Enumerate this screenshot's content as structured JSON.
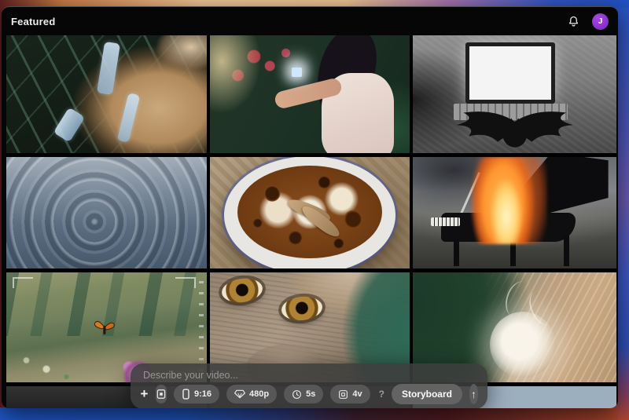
{
  "header": {
    "title": "Featured",
    "avatar_initial": "J"
  },
  "gallery": {
    "tiles": [
      {
        "description": "Macro of translucent glass straws among dark seaweed strands"
      },
      {
        "description": "Girl in a greenhouse holding a small glowing cube above her hands"
      },
      {
        "description": "Black-and-white shot of a bat spreading wings in front of an open laptop"
      },
      {
        "description": "Concentric ripples spreading on calm blue-grey water"
      },
      {
        "description": "Top-down coffee cup with foam bubbles and an insect on the surface"
      },
      {
        "description": "Grand piano burning with orange flames on a grey beach"
      },
      {
        "description": "Orange butterfly flying over rolling green hills with a pink flower"
      },
      {
        "description": "Close-up of a monkey's amber eyes beside teal leaves"
      },
      {
        "description": "White dandelion seed head nestled in strands of blonde hair"
      },
      {
        "description": "Partially visible video thumbnail"
      },
      {
        "description": "Partially visible video thumbnail"
      },
      {
        "description": "Partially visible video thumbnail"
      }
    ]
  },
  "prompt_bar": {
    "placeholder": "Describe your video...",
    "controls": {
      "add": "+",
      "aspect_ratio": "9:16",
      "resolution": "480p",
      "duration": "5s",
      "variations": "4v",
      "help": "?",
      "storyboard": "Storyboard",
      "send": "↑"
    }
  },
  "colors": {
    "avatar_accent": "#8b2fc9",
    "window_bg": "#060606",
    "prompt_bar_bg": "#3e3e3e",
    "wallpaper_top": [
      "#5e1f1f",
      "#efc493",
      "#a171ae",
      "#2150c0"
    ],
    "wallpaper_bottom": [
      "#1e56c8",
      "#501a20",
      "#a8442c"
    ]
  }
}
